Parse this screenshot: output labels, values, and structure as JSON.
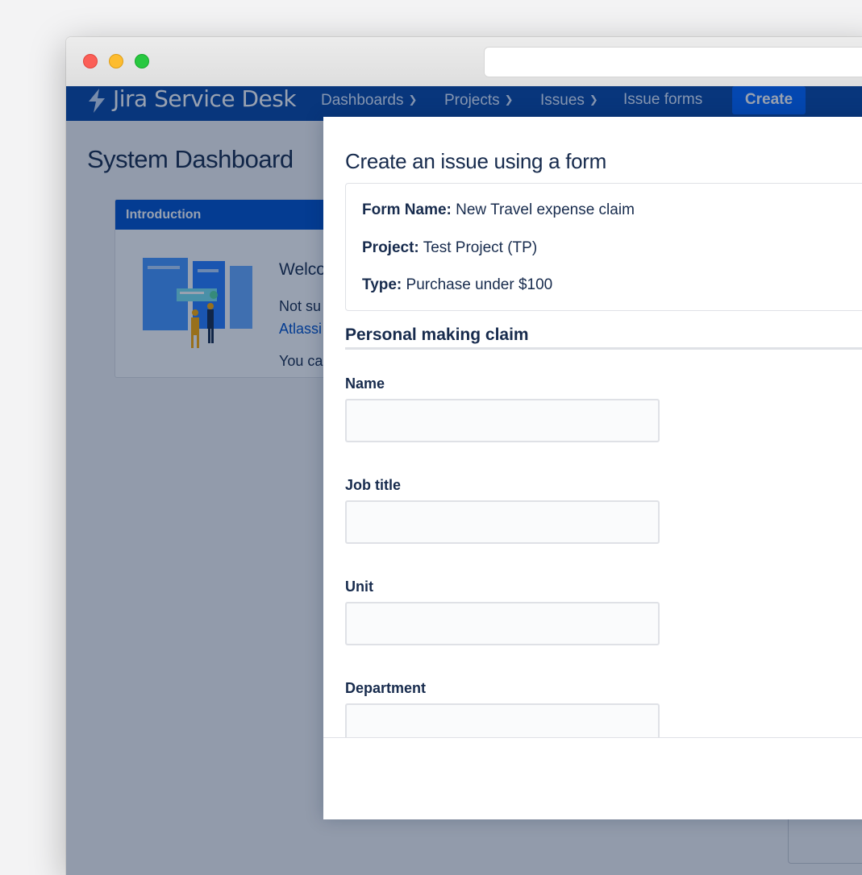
{
  "topnav": {
    "logo_text": "Jira Service Desk",
    "items": [
      {
        "label": "Dashboards",
        "has_dropdown": true
      },
      {
        "label": "Projects",
        "has_dropdown": true
      },
      {
        "label": "Issues",
        "has_dropdown": true
      },
      {
        "label": "Issue forms",
        "has_dropdown": false
      }
    ],
    "create_label": "Create"
  },
  "dashboard": {
    "title": "System Dashboard",
    "gadget": {
      "header": "Introduction",
      "welcome_title": "Welco",
      "line1": "Not su",
      "line2_link": "Atlassi",
      "line3": "You ca"
    }
  },
  "modal": {
    "title": "Create an issue using a form",
    "info": {
      "form_name_label": "Form Name:",
      "form_name_value": "New Travel expense claim",
      "project_label": "Project:",
      "project_value": "Test Project (TP)",
      "type_label": "Type:",
      "type_value": "Purchase under $100"
    },
    "section_title": "Personal making claim",
    "fields": [
      {
        "label": "Name",
        "value": ""
      },
      {
        "label": "Job title",
        "value": ""
      },
      {
        "label": "Unit",
        "value": ""
      },
      {
        "label": "Department",
        "value": ""
      }
    ]
  },
  "colors": {
    "nav_background": "#0747a6",
    "create_button": "#0065ff",
    "gadget_header": "#0052cc",
    "text_primary": "#172b4d",
    "link": "#0052cc"
  },
  "icons": {
    "logo": "jira-bolt-icon",
    "dropdown": "chevron-down-icon"
  }
}
